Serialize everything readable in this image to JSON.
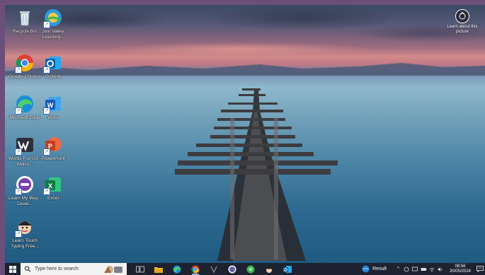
{
  "desktop": {
    "icons": [
      {
        "label": "Recycle Bin",
        "icon": "recycle-bin-icon"
      },
      {
        "label": "Join Valley Learning...",
        "icon": "join-valley-learning-icon"
      },
      {
        "label": "Google Chrome",
        "icon": "chrome-icon"
      },
      {
        "label": "Outlook",
        "icon": "outlook-icon"
      },
      {
        "label": "Microsoft Edge",
        "icon": "edge-icon"
      },
      {
        "label": "Word",
        "icon": "word-icon"
      },
      {
        "label": "Words Fox US - Welco...",
        "icon": "words-fox-icon"
      },
      {
        "label": "PowerPoint",
        "icon": "powerpoint-icon"
      },
      {
        "label": "Learn My Way - Devel...",
        "icon": "learn-my-way-icon"
      },
      {
        "label": "Excel",
        "icon": "excel-icon"
      },
      {
        "label": "Learn Touch Typing Free...",
        "icon": "learn-touch-typing-icon"
      }
    ],
    "spotlight_widget": {
      "label": "Learn about this picture",
      "icon": "camera-lens-icon"
    }
  },
  "taskbar": {
    "search_placeholder": "Type here to search",
    "apps": [
      {
        "name": "task-view",
        "icon": "task-view-icon",
        "running": false
      },
      {
        "name": "file-explorer",
        "icon": "folder-icon",
        "running": false
      },
      {
        "name": "edge",
        "icon": "edge-icon",
        "running": false
      },
      {
        "name": "chrome",
        "icon": "chrome-icon",
        "running": true
      },
      {
        "name": "widgets",
        "icon": "widget-icon",
        "running": false
      },
      {
        "name": "teams",
        "icon": "teams-icon",
        "running": false
      },
      {
        "name": "app-green",
        "icon": "green-app-icon",
        "running": false
      },
      {
        "name": "typing-app",
        "icon": "character-icon",
        "running": false
      },
      {
        "name": "outlook",
        "icon": "outlook-icon",
        "running": false
      }
    ],
    "weather": {
      "label": "Result",
      "icon": "weather-icon"
    },
    "clock": {
      "time": "08:56",
      "date": "20/05/2024"
    }
  },
  "colors": {
    "taskbar": "#1c2230",
    "frame": "#6b4f7a"
  }
}
